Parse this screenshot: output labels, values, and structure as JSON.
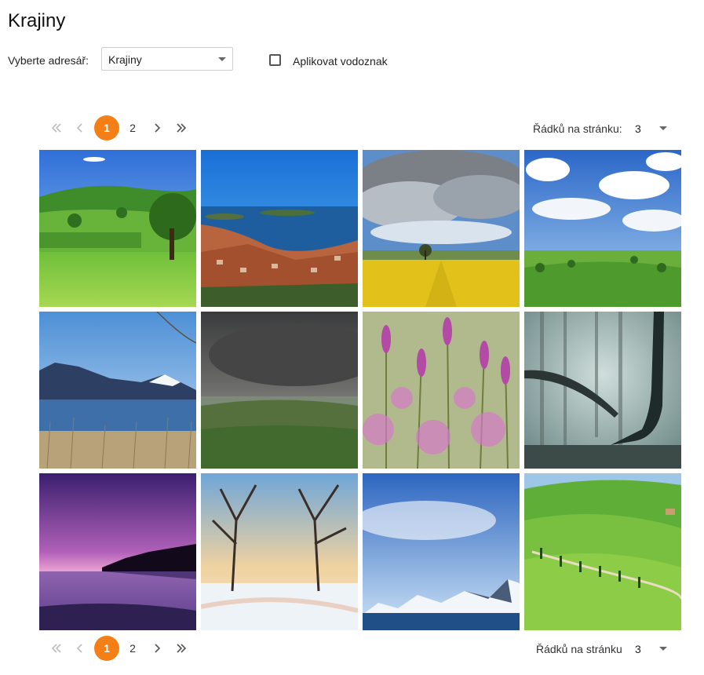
{
  "page": {
    "title": "Krajiny"
  },
  "controls": {
    "directory_label": "Vyberte adresář:",
    "directory_value": "Krajiny",
    "watermark_label": "Aplikovat vodoznak",
    "watermark_checked": false
  },
  "pagination_top": {
    "pages": [
      "1",
      "2"
    ],
    "current_page": "1",
    "rows_label": "Řádků na stránku:",
    "rows_value": "3"
  },
  "pagination_bottom": {
    "pages": [
      "1",
      "2"
    ],
    "current_page": "1",
    "rows_label": "Řádků na stránku",
    "rows_value": "3"
  },
  "colors": {
    "accent": "#f57f17"
  },
  "gallery": {
    "images": [
      {
        "subject": "green meadow with trees"
      },
      {
        "subject": "coastal town and sea"
      },
      {
        "subject": "cloudy sky over yellow field"
      },
      {
        "subject": "blue sky with clouds over green plain"
      },
      {
        "subject": "mountain lake with reeds"
      },
      {
        "subject": "stormy clouds over hills"
      },
      {
        "subject": "purple lavender flowers"
      },
      {
        "subject": "foggy forest with trees"
      },
      {
        "subject": "purple sunset over lake"
      },
      {
        "subject": "snowy winter trees"
      },
      {
        "subject": "snowy mountains and blue sea"
      },
      {
        "subject": "green tuscan hills with cypress trees"
      }
    ]
  }
}
